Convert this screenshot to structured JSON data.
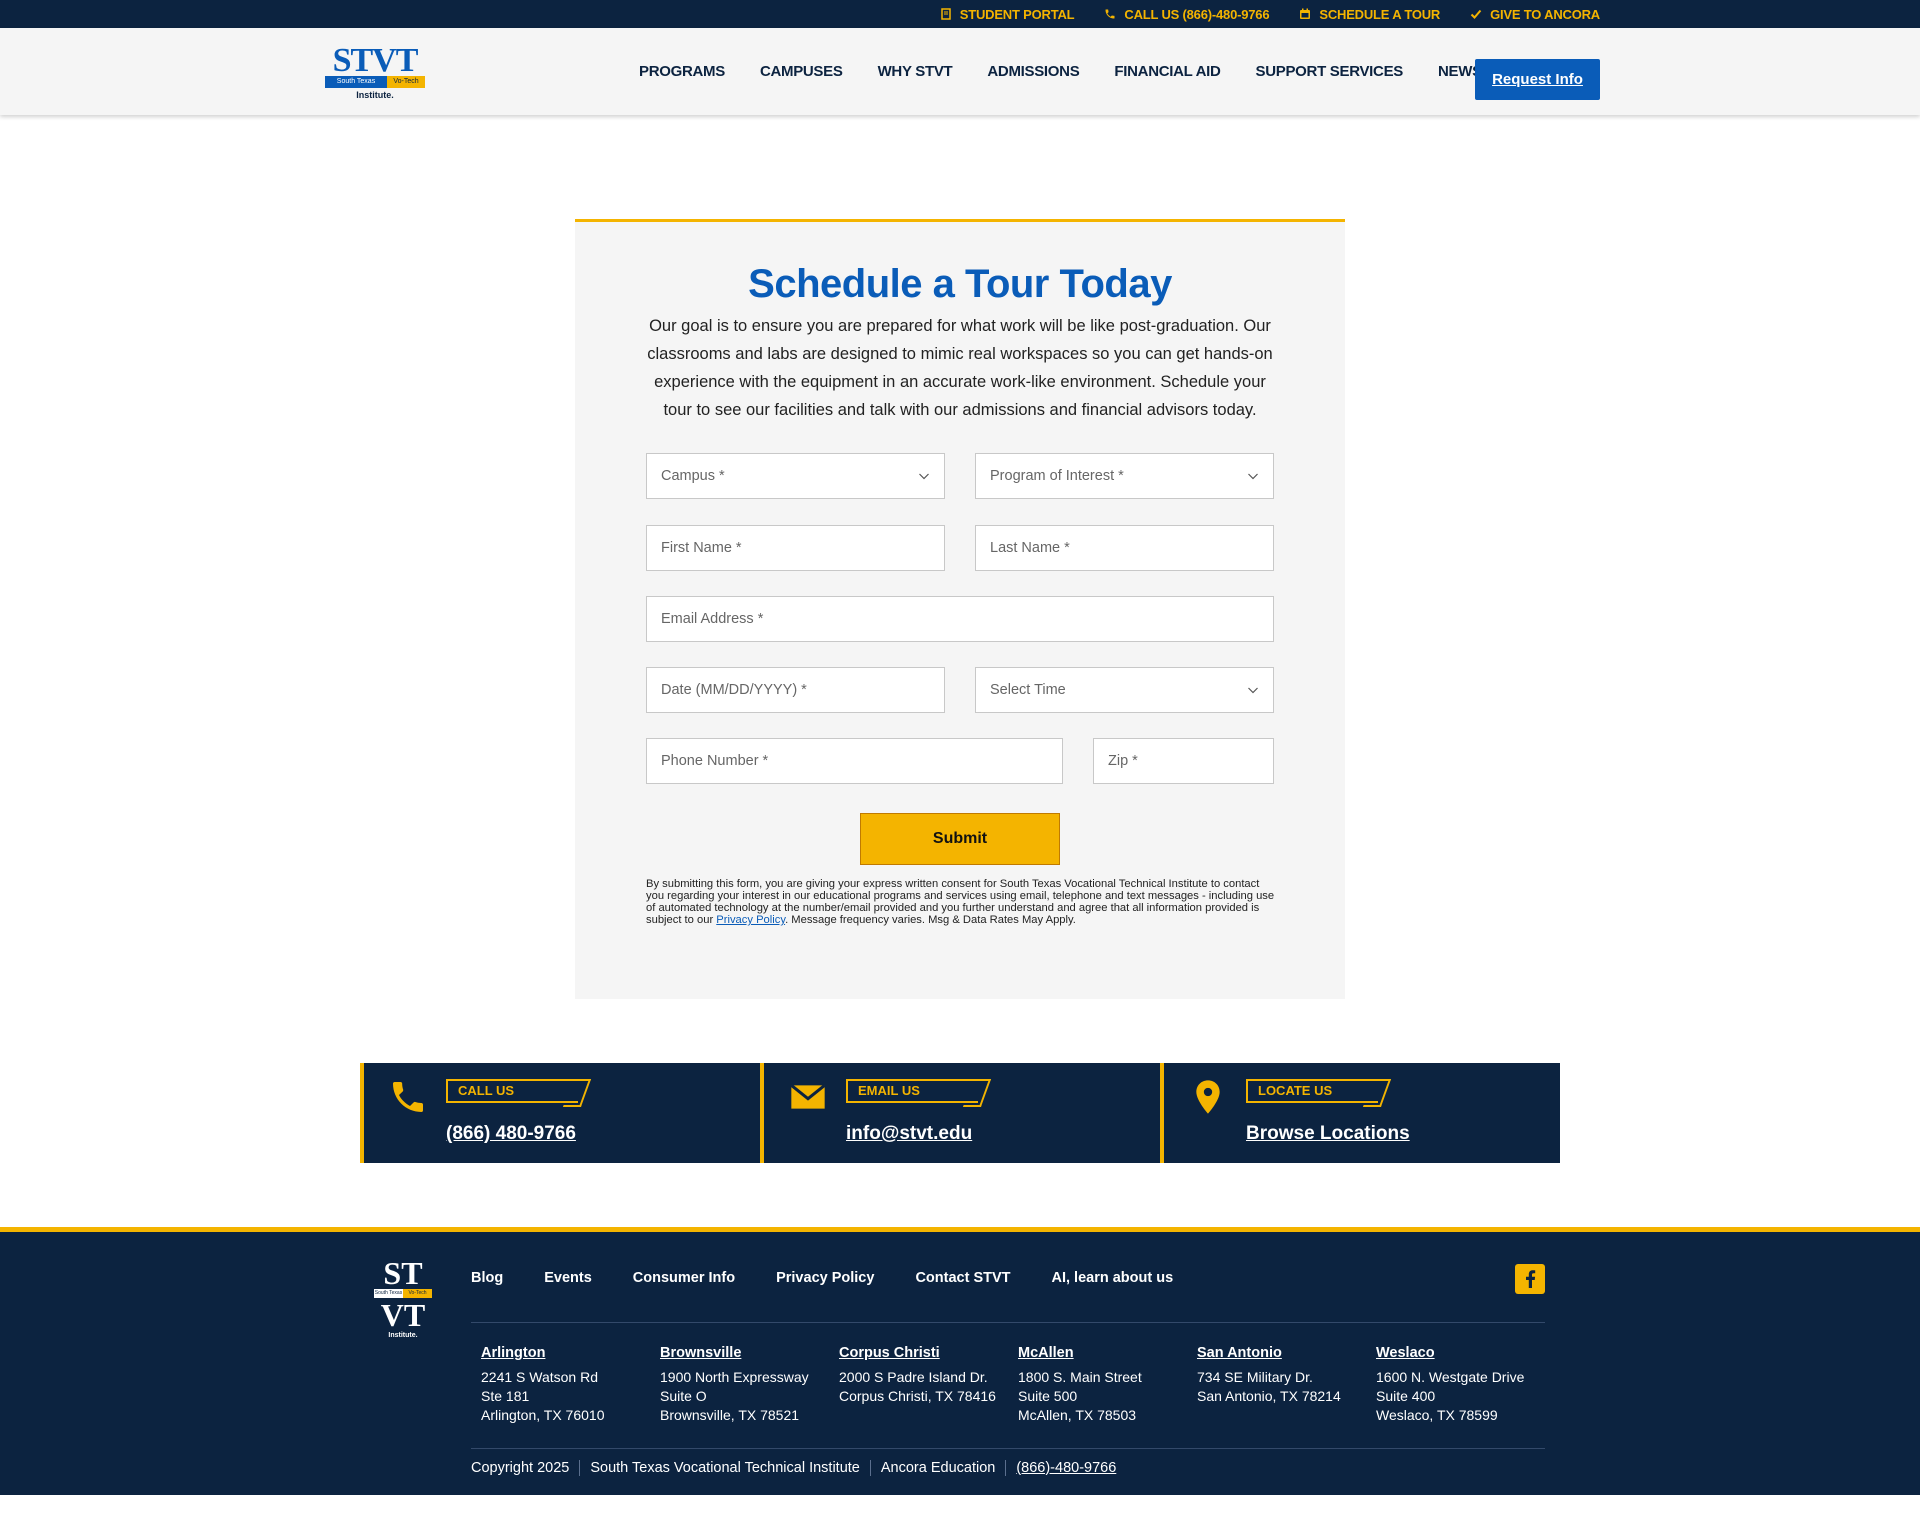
{
  "topbar": {
    "links": [
      {
        "label": "STUDENT PORTAL",
        "icon": "portal-icon"
      },
      {
        "label": "CALL US (866)-480-9766",
        "icon": "phone-icon"
      },
      {
        "label": "SCHEDULE A TOUR",
        "icon": "calendar-icon"
      },
      {
        "label": "GIVE TO ANCORA",
        "icon": "check-icon"
      }
    ]
  },
  "header": {
    "logo": {
      "main": "STVT",
      "band_left": "South Texas",
      "band_right": "Vo-Tech",
      "sub": "Institute."
    },
    "nav": [
      "PROGRAMS",
      "CAMPUSES",
      "WHY STVT",
      "ADMISSIONS",
      "FINANCIAL AID",
      "SUPPORT SERVICES",
      "NEWSROOM"
    ],
    "request_button": "Request Info"
  },
  "form": {
    "title": "Schedule a Tour Today",
    "intro": "Our goal is to ensure you are prepared for what work will be like post-graduation. Our classrooms and labs are designed to mimic real workspaces so you can get hands-on experience with the equipment in an accurate work-like environment. Schedule your tour to see our facilities and talk with our admissions and financial advisors today.",
    "campus": "Campus *",
    "program": "Program of Interest *",
    "first_name": "First Name *",
    "last_name": "Last Name *",
    "email": "Email Address *",
    "date": "Date (MM/DD/YYYY) *",
    "time": "Select Time",
    "phone": "Phone Number *",
    "zip": "Zip *",
    "submit": "Submit",
    "disclaimer_before": "By submitting this form, you are giving your express written consent for South Texas Vocational Technical Institute to contact you regarding your interest in our educational programs and services using email, telephone and text messages - including use of automated technology at the number/email provided and you further understand and agree that all information provided is subject to our ",
    "disclaimer_link": "Privacy Policy",
    "disclaimer_after": ". Message frequency varies. Msg & Data Rates May Apply."
  },
  "contact": [
    {
      "tag": "CALL US",
      "value": "(866) 480-9766",
      "icon": "phone-icon"
    },
    {
      "tag": "EMAIL US",
      "value": "info@stvt.edu",
      "icon": "envelope-icon"
    },
    {
      "tag": "LOCATE US",
      "value": "Browse Locations",
      "icon": "map-pin-icon"
    }
  ],
  "footer": {
    "logo": {
      "line1": "ST",
      "line2": "VT",
      "band_left": "South Texas",
      "band_right": "Vo-Tech",
      "sub": "Institute."
    },
    "links": [
      "Blog",
      "Events",
      "Consumer Info",
      "Privacy Policy",
      "Contact STVT",
      "AI, learn about us"
    ],
    "social_icon": "facebook-icon",
    "locations": [
      {
        "city": "Arlington",
        "lines": [
          "2241 S Watson Rd",
          "Ste 181",
          "Arlington, TX 76010"
        ]
      },
      {
        "city": "Brownsville",
        "lines": [
          "1900 North Expressway",
          "Suite O",
          "Brownsville, TX 78521"
        ]
      },
      {
        "city": "Corpus Christi",
        "lines": [
          "2000 S Padre Island Dr.",
          "Corpus Christi, TX 78416"
        ]
      },
      {
        "city": "McAllen",
        "lines": [
          "1800 S. Main Street",
          "Suite 500",
          "McAllen, TX 78503"
        ]
      },
      {
        "city": "San Antonio",
        "lines": [
          "734 SE Military Dr.",
          "San Antonio, TX 78214"
        ]
      },
      {
        "city": "Weslaco",
        "lines": [
          "1600 N. Westgate Drive",
          "Suite 400",
          "Weslaco, TX 78599"
        ]
      }
    ],
    "copyright": "Copyright 2025",
    "org": "South Texas Vocational Technical Institute",
    "parent": "Ancora Education",
    "phone": "(866)-480-9766"
  },
  "colors": {
    "navy": "#0c2340",
    "gold": "#f4b400",
    "blue": "#0a5cb8"
  }
}
